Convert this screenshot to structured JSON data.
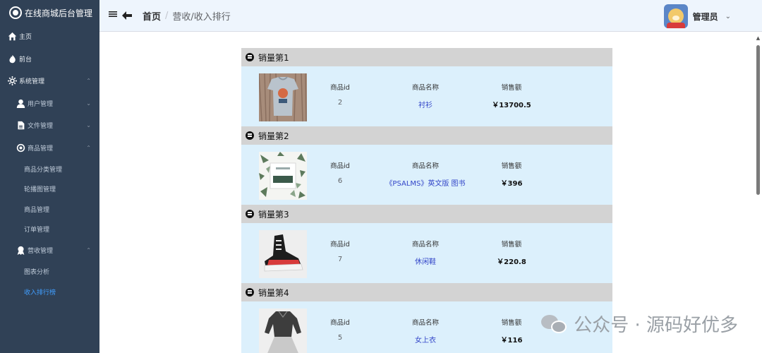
{
  "app": {
    "title": "在线商城后台管理"
  },
  "sidebar": {
    "items": [
      {
        "label": "主页",
        "icon": "home-icon"
      },
      {
        "label": "前台",
        "icon": "fire-icon"
      },
      {
        "label": "系统管理",
        "icon": "gear-icon",
        "arrow": "⌃"
      },
      {
        "label": "用户管理",
        "icon": "user-icon",
        "arrow": "⌄"
      },
      {
        "label": "文件管理",
        "icon": "file-icon",
        "arrow": "⌄"
      },
      {
        "label": "商品管理",
        "icon": "goods-icon",
        "arrow": "⌃"
      },
      {
        "label": "商品分类管理"
      },
      {
        "label": "轮播图管理"
      },
      {
        "label": "商品管理"
      },
      {
        "label": "订单管理"
      },
      {
        "label": "营收管理",
        "icon": "revenue-icon",
        "arrow": "⌃"
      },
      {
        "label": "图表分析"
      },
      {
        "label": "收入排行榜"
      }
    ]
  },
  "header": {
    "breadcrumb_home": "首页",
    "breadcrumb_sep": "/",
    "breadcrumb_current": "营收/收入排行",
    "user_name": "管理员",
    "caret": "⌄"
  },
  "ranks": [
    {
      "title": "销量第1",
      "id_label": "商品id",
      "name_label": "商品名称",
      "sales_label": "销售额",
      "id": "2",
      "name": "衬衫",
      "sales": "￥13700.5",
      "image": "tshirt"
    },
    {
      "title": "销量第2",
      "id_label": "商品id",
      "name_label": "商品名称",
      "sales_label": "销售额",
      "id": "6",
      "name": "《PSALMS》英文版 图书",
      "sales": "￥396",
      "image": "book"
    },
    {
      "title": "销量第3",
      "id_label": "商品id",
      "name_label": "商品名称",
      "sales_label": "销售额",
      "id": "7",
      "name": "休闲鞋",
      "sales": "￥220.8",
      "image": "shoe"
    },
    {
      "title": "销量第4",
      "id_label": "商品id",
      "name_label": "商品名称",
      "sales_label": "销售额",
      "id": "5",
      "name": "女上衣",
      "sales": "￥116",
      "image": "blouse"
    }
  ],
  "watermark": {
    "text": "公众号 · 源码好优多"
  },
  "colors": {
    "sidebar_bg": "#304156",
    "header_bg": "#eef5fd",
    "rank_head_bg": "#d3d3d3",
    "rank_body_bg": "#dcf0fc",
    "active": "#409eff"
  }
}
